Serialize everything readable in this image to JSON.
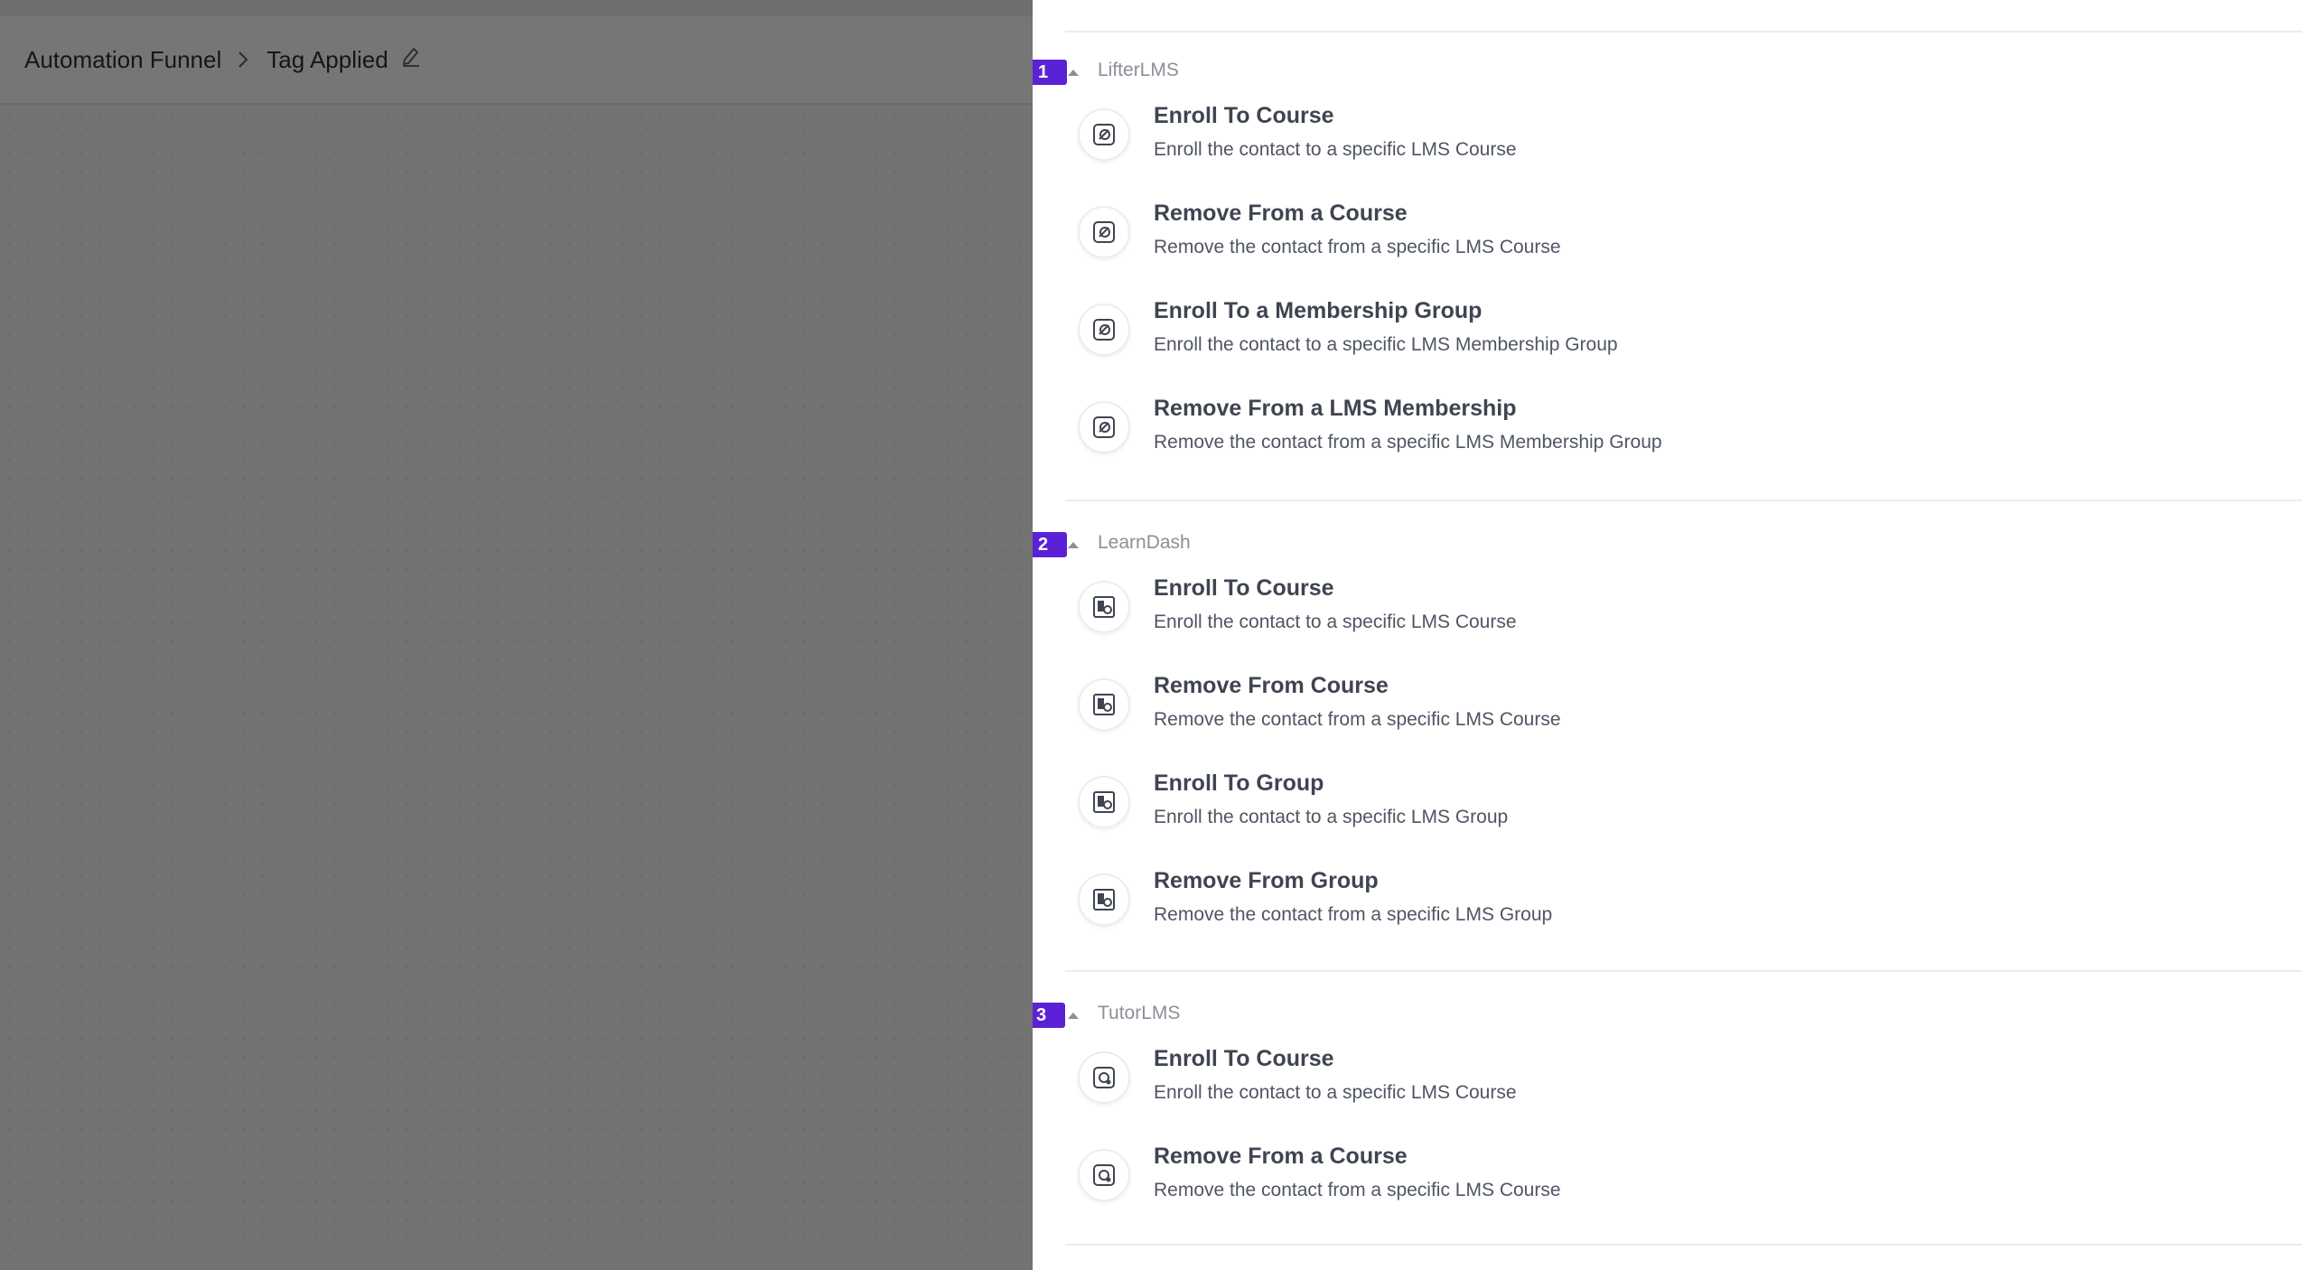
{
  "breadcrumb": {
    "root": "Automation Funnel",
    "current": "Tag Applied"
  },
  "colors": {
    "badge": "#5b21d6",
    "overlay": "#737373",
    "panel": "#ffffff"
  },
  "groups": [
    {
      "badge": "1",
      "name": "LifterLMS",
      "icon": "lifterlms-icon",
      "items": [
        {
          "title": "Enroll To Course",
          "desc": "Enroll the contact to a specific LMS Course"
        },
        {
          "title": "Remove From a Course",
          "desc": "Remove the contact from a specific LMS Course"
        },
        {
          "title": "Enroll To a Membership Group",
          "desc": "Enroll the contact to a specific LMS Membership Group"
        },
        {
          "title": "Remove From a LMS Membership",
          "desc": "Remove the contact from a specific LMS Membership Group"
        }
      ]
    },
    {
      "badge": "2",
      "name": "LearnDash",
      "icon": "learndash-icon",
      "items": [
        {
          "title": "Enroll To Course",
          "desc": "Enroll the contact to a specific LMS Course"
        },
        {
          "title": "Remove From Course",
          "desc": "Remove the contact from a specific LMS Course"
        },
        {
          "title": "Enroll To Group",
          "desc": "Enroll the contact to a specific LMS Group"
        },
        {
          "title": "Remove From Group",
          "desc": "Remove the contact from a specific LMS Group"
        }
      ]
    },
    {
      "badge": "3",
      "name": "TutorLMS",
      "icon": "tutorlms-icon",
      "items": [
        {
          "title": "Enroll To Course",
          "desc": "Enroll the contact to a specific LMS Course"
        },
        {
          "title": "Remove From a Course",
          "desc": "Remove the contact from a specific LMS Course"
        }
      ]
    }
  ]
}
